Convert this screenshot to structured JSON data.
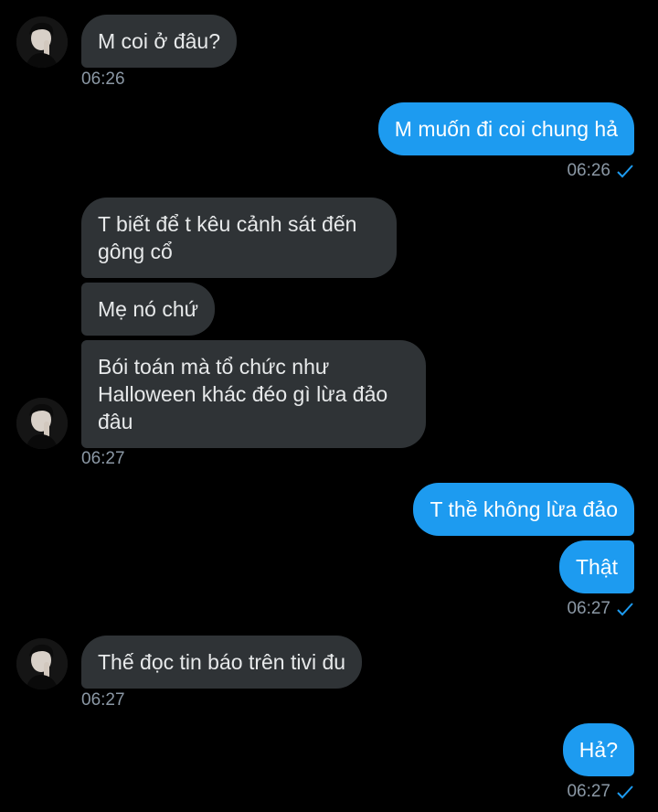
{
  "colors": {
    "background": "#000000",
    "incoming_bubble": "#2F3336",
    "outgoing_bubble": "#1D9BF0",
    "timestamp": "#8B98A5",
    "read_check": "#1D9BF0"
  },
  "messages": [
    {
      "id": "m1",
      "direction": "incoming",
      "text": "M coi ở đâu?"
    },
    {
      "id": "m2",
      "direction": "outgoing",
      "text": "M muốn đi coi chung hả"
    },
    {
      "id": "m3",
      "direction": "incoming",
      "text": "T biết để t kêu cảnh sát đến gông cổ"
    },
    {
      "id": "m4",
      "direction": "incoming",
      "text": "Mẹ nó chứ"
    },
    {
      "id": "m5",
      "direction": "incoming",
      "text": "Bói toán mà tổ chức như Halloween khác đéo gì lừa đảo đâu"
    },
    {
      "id": "m6",
      "direction": "outgoing",
      "text": "T thề không lừa đảo"
    },
    {
      "id": "m7",
      "direction": "outgoing",
      "text": "Thật"
    },
    {
      "id": "m8",
      "direction": "incoming",
      "text": "Thế đọc tin báo trên tivi đu"
    },
    {
      "id": "m9",
      "direction": "outgoing",
      "text": "Hả?"
    }
  ],
  "timestamps": {
    "g1": "06:26",
    "g2": "06:26",
    "g3": "06:27",
    "g4": "06:27",
    "g5": "06:27",
    "g6": "06:27"
  },
  "icons": {
    "avatar": "contact-avatar",
    "read_receipt": "read-check-icon"
  }
}
